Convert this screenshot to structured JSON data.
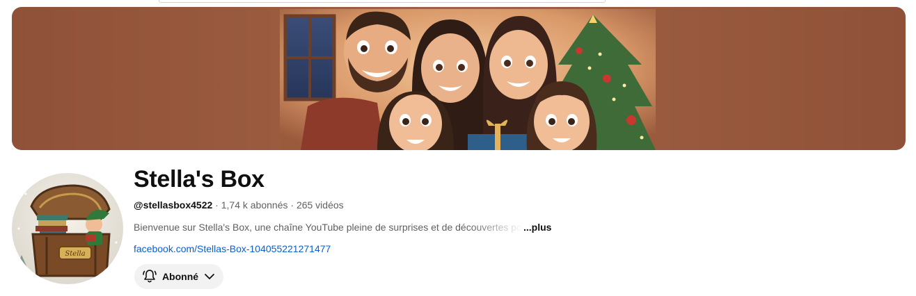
{
  "channel": {
    "name": "Stella's Box",
    "handle": "@stellasbox4522",
    "separator": " · ",
    "subscribers": "1,74 k abonnés",
    "videos": "265 vidéos",
    "description": "Bienvenue sur Stella's Box, une chaîne YouTube pleine de surprises et de découvertes pour",
    "more_label": "...plus",
    "link_text": "facebook.com/Stellas-Box-104055221271477",
    "avatar_label": "Stella"
  },
  "subscribe": {
    "label": "Abonné",
    "icon": "bell-icon",
    "dropdown_icon": "chevron-down-icon"
  },
  "colors": {
    "banner_bg": "#9a5b3f",
    "link": "#065fd4",
    "button_bg": "#f2f2f2"
  }
}
